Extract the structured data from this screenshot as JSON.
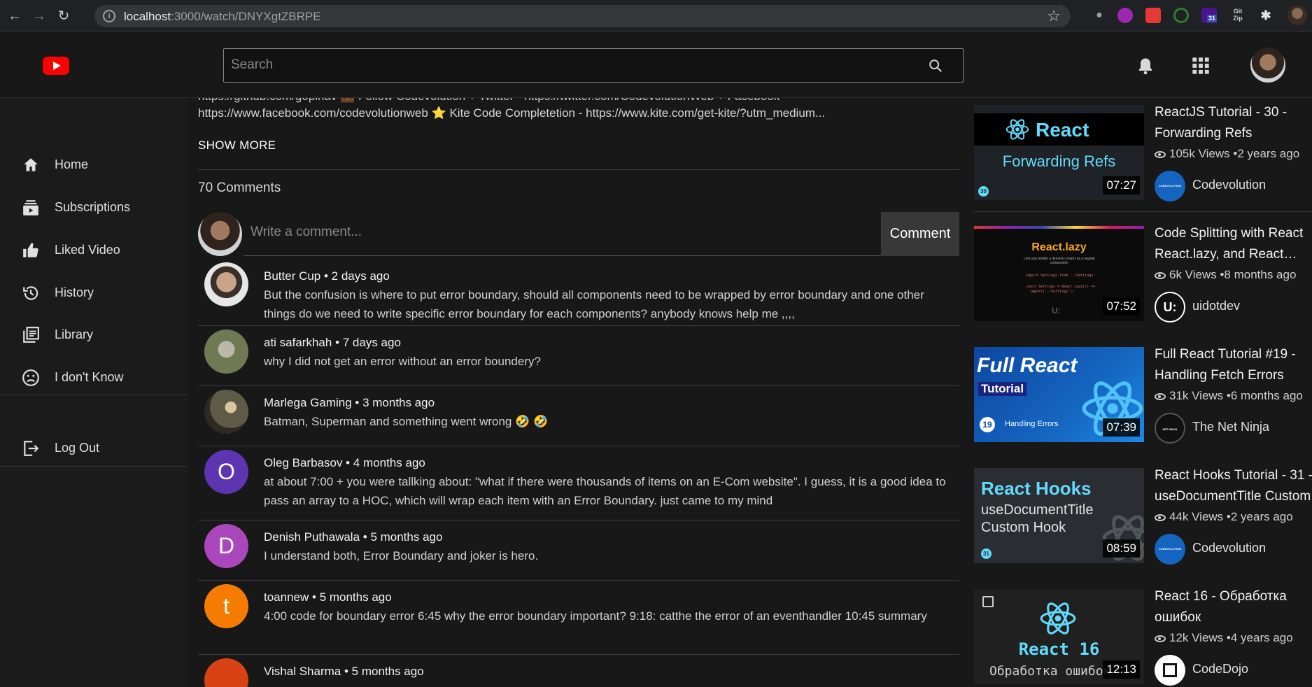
{
  "browser": {
    "url_host": "localhost",
    "url_path": ":3000/watch/DNYXgtZBRPE",
    "info_glyph": "i",
    "badge_count": "31",
    "gitzip_label": "Git Zip"
  },
  "header": {
    "search_placeholder": "Search"
  },
  "sidebar": {
    "items": [
      {
        "label": "Home",
        "icon": "home-icon"
      },
      {
        "label": "Subscriptions",
        "icon": "subscriptions-icon"
      },
      {
        "label": "Liked Video",
        "icon": "thumb-up-icon"
      },
      {
        "label": "History",
        "icon": "history-icon"
      },
      {
        "label": "Library",
        "icon": "library-icon"
      },
      {
        "label": "I don't Know",
        "icon": "sad-face-icon"
      }
    ],
    "logout_label": "Log Out"
  },
  "description": {
    "partial_line": "https://github.com/gopinav 💼 Follow Codevolution + Twitter - https://twitter.com/CodevolutionWeb + Facebook -",
    "line": "https://www.facebook.com/codevolutionweb ⭐ Kite Code Completetion - https://www.kite.com/get-kite/?utm_medium...",
    "show_more": "SHOW MORE"
  },
  "comments_section": {
    "count_label": "70 Comments",
    "input_placeholder": "Write a comment...",
    "submit_label": "Comment",
    "comments": [
      {
        "author": "Butter Cup",
        "age": "2 days ago",
        "text": "But the confusion is where to put error boundary, should all components need to be wrapped by error boundary and one other things do we need to write specific error boundary for each components? anybody knows help me ,,,,",
        "initial": "",
        "color": "#d9d4cf"
      },
      {
        "author": "ati safarkhah",
        "age": "7 days ago",
        "text": "why I did not get an error without an error boundery?",
        "initial": "",
        "color": "#6f7a55"
      },
      {
        "author": "Marlega Gaming",
        "age": "3 months ago",
        "text": "Batman, Superman and something went wrong 🤣 🤣",
        "initial": "",
        "color": "#5d5a48"
      },
      {
        "author": "Oleg Barbasov",
        "age": "4 months ago",
        "text": "at about 7:00 + you were tallking about: \"what if there were thousands of items on an E-Com website\". I guess, it is a good idea to pass an array to a HOC, which will wrap each item with an Error Boundary. just came to my mind",
        "initial": "O",
        "color": "#5e35b1"
      },
      {
        "author": "Denish Puthawala",
        "age": "5 months ago",
        "text": "I understand both, Error Boundary and joker is hero.",
        "initial": "D",
        "color": "#ab47bc"
      },
      {
        "author": "toannew",
        "age": "5 months ago",
        "text": "4:00 code for boundary error 6:45 why the error boundary important? 9:18: catthe the error of an eventhandler 10:45 summary",
        "initial": "t",
        "color": "#f57c00"
      },
      {
        "author": "Vishal Sharma",
        "age": "5 months ago",
        "text": "",
        "initial": "",
        "color": "#d84315"
      }
    ]
  },
  "related": [
    {
      "title_1": "ReactJS Tutorial - 30 -",
      "title_2": "Forwarding Refs",
      "views": "105k Views",
      "age": "•2 years ago",
      "channel": "Codevolution",
      "duration": "07:27",
      "thumb_title": "React",
      "thumb_sub": "Forwarding Refs",
      "thumb_badge": "30",
      "channel_logo": "CODEVOLUTION"
    },
    {
      "title_1": "Code Splitting with React",
      "title_2": "React.lazy, and React…",
      "views": "6k Views",
      "age": "•8 months ago",
      "channel": "uidotdev",
      "duration": "07:52",
      "thumb_title": "React.lazy",
      "thumb_sub": "Lets you render a dynamic import as a regular component.",
      "thumb_code_1": "import Settings from './Settings'",
      "thumb_code_2": "const Settings = React.lazy(() =>",
      "thumb_code_3": "import('./Settings'))",
      "thumb_mark": "U:",
      "channel_logo": "U:"
    },
    {
      "title_1": "Full React Tutorial #19 -",
      "title_2": "Handling Fetch Errors",
      "views": "31k Views",
      "age": "•6 months ago",
      "channel": "The Net Ninja",
      "duration": "07:39",
      "thumb_title": "Full React",
      "thumb_sub": "Tutorial",
      "thumb_caption": "Handling Errors",
      "thumb_badge": "19",
      "channel_logo": "NET NINJA"
    },
    {
      "title_1": "React Hooks Tutorial - 31 -",
      "title_2": "useDocumentTitle Custom Hook",
      "views": "44k Views",
      "age": "•2 years ago",
      "channel": "Codevolution",
      "duration": "08:59",
      "thumb_title": "React Hooks",
      "thumb_sub": "useDocumentTitle",
      "thumb_sub2": "Custom Hook",
      "thumb_badge": "31",
      "channel_logo": "CODEVOLUTION"
    },
    {
      "title_1": "React 16 - Обработка",
      "title_2": "ошибок",
      "views": "12k Views",
      "age": "•4 years ago",
      "channel": "CodeDojo",
      "duration": "12:13",
      "thumb_title": "React 16",
      "thumb_sub": "Обработка ошибок"
    }
  ]
}
